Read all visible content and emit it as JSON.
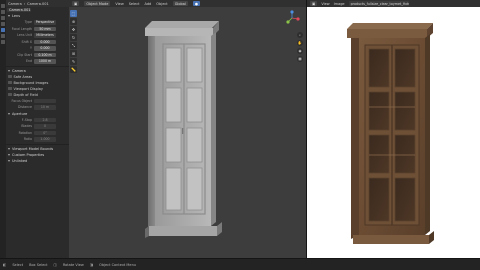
{
  "properties": {
    "breadcrumb": [
      "Camera",
      "Camera.001"
    ],
    "object_name": "Camera.001",
    "lens_section": "Lens",
    "fields": [
      {
        "label": "Type",
        "value": "Perspective"
      },
      {
        "label": "Focal Length",
        "value": "50 mm"
      },
      {
        "label": "Lens Unit",
        "value": "Millimeters"
      },
      {
        "label": "Shift X",
        "value": "0.000"
      },
      {
        "label": "Y",
        "value": "0.000"
      },
      {
        "label": "Clip Start",
        "value": "0.100 m"
      },
      {
        "label": "End",
        "value": "1000 m"
      }
    ],
    "camera_section": "Camera",
    "checks": [
      "Safe Areas",
      "Background Images",
      "Viewport Display",
      "Depth of Field"
    ],
    "focus_fields": [
      {
        "label": "Focus Object",
        "value": ""
      },
      {
        "label": "Distance",
        "value": "10 m"
      }
    ],
    "aperture_section": "Aperture",
    "aperture_fields": [
      {
        "label": "F-Stop",
        "value": "2.8"
      },
      {
        "label": "Blades",
        "value": "0"
      },
      {
        "label": "Rotation",
        "value": "0°"
      },
      {
        "label": "Ratio",
        "value": "1.000"
      }
    ],
    "bottom_sections": [
      "Viewport Model Bounds",
      "Custom Properties",
      "Unlinked"
    ]
  },
  "viewport": {
    "menus": [
      "View",
      "Select",
      "Add",
      "Object"
    ],
    "mode": "Object Mode",
    "global": "Global",
    "icons": [
      "hand-icon",
      "zoom-icon",
      "camera-icon",
      "grid-icon"
    ]
  },
  "viewer": {
    "menus": [
      "View",
      "Image"
    ],
    "file_name": "products_fullsize_clear_toymet_fixture_0006d.jpg"
  },
  "statusbar": {
    "items": [
      "Select",
      "Box Select",
      "Rotate View",
      "Object Context Menu"
    ]
  },
  "colors": {
    "accent": "#4772b3",
    "viewport_bg": "#3d3d3d",
    "panel_bg": "#2b2b2b"
  }
}
